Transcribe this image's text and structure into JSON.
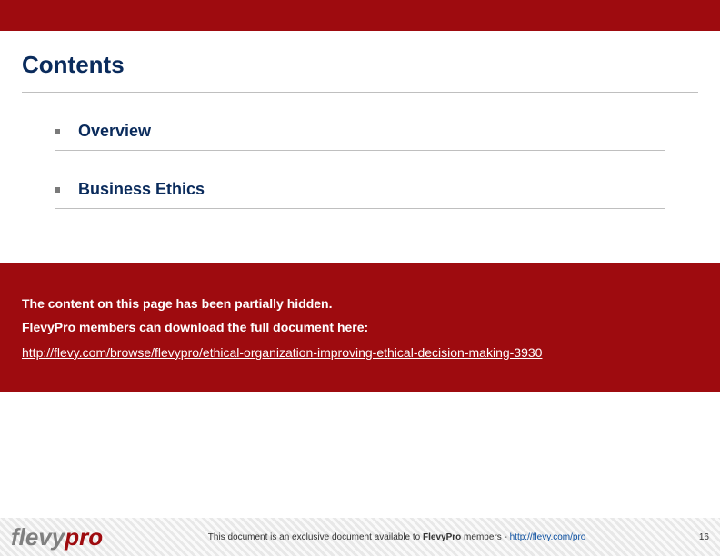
{
  "header": {
    "title": "Contents"
  },
  "toc": {
    "items": [
      {
        "label": "Overview"
      },
      {
        "label": "Business Ethics"
      }
    ]
  },
  "notice": {
    "line1": "The content on this page has been partially hidden.",
    "line2": "FlevyPro members can download the full document here:",
    "url": "http://flevy.com/browse/flevypro/ethical-organization-improving-ethical-decision-making-3930"
  },
  "footer": {
    "logo_part1": "flevy",
    "logo_part2": "pro",
    "disclaimer_prefix": "This document is an exclusive document available to ",
    "disclaimer_bold": "FlevyPro",
    "disclaimer_suffix": " members - ",
    "link_text": "http://flevy.com/pro",
    "page_number": "16"
  }
}
